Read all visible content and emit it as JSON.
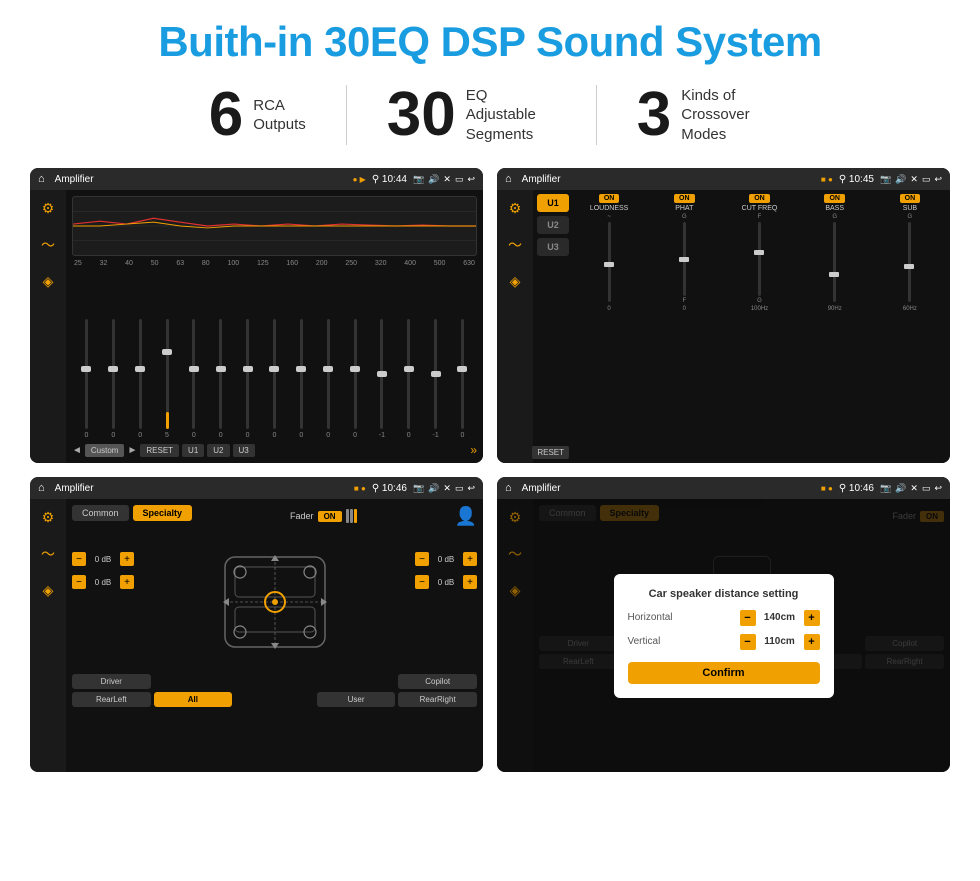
{
  "page": {
    "title": "Buith-in 30EQ DSP Sound System",
    "background": "#ffffff"
  },
  "stats": [
    {
      "number": "6",
      "desc_line1": "RCA",
      "desc_line2": "Outputs"
    },
    {
      "number": "30",
      "desc_line1": "EQ Adjustable",
      "desc_line2": "Segments"
    },
    {
      "number": "3",
      "desc_line1": "Kinds of",
      "desc_line2": "Crossover Modes"
    }
  ],
  "screens": [
    {
      "id": "eq-screen",
      "status_bar": {
        "app_name": "Amplifier",
        "time": "10:44"
      },
      "eq": {
        "freqs": [
          "25",
          "32",
          "40",
          "50",
          "63",
          "80",
          "100",
          "125",
          "160",
          "200",
          "250",
          "320",
          "400",
          "500",
          "630"
        ],
        "values": [
          "0",
          "0",
          "0",
          "5",
          "0",
          "0",
          "0",
          "0",
          "0",
          "0",
          "0",
          "-1",
          "0",
          "-1"
        ],
        "mode": "Custom",
        "buttons": [
          "RESET",
          "U1",
          "U2",
          "U3"
        ]
      }
    },
    {
      "id": "crossover-screen",
      "status_bar": {
        "app_name": "Amplifier",
        "time": "10:45"
      },
      "presets": [
        "U1",
        "U2",
        "U3"
      ],
      "channels": [
        {
          "label": "LOUDNESS",
          "on": true
        },
        {
          "label": "PHAT",
          "on": true
        },
        {
          "label": "CUT FREQ",
          "on": true
        },
        {
          "label": "BASS",
          "on": true
        },
        {
          "label": "SUB",
          "on": true
        }
      ]
    },
    {
      "id": "fader-screen",
      "status_bar": {
        "app_name": "Amplifier",
        "time": "10:46"
      },
      "tabs": [
        "Common",
        "Specialty"
      ],
      "fader_label": "Fader",
      "fader_on": true,
      "db_values": [
        "0 dB",
        "0 dB",
        "0 dB",
        "0 dB"
      ],
      "bottom_btns": [
        "Driver",
        "",
        "",
        "",
        "Copilot"
      ],
      "bottom_btns2": [
        "RearLeft",
        "All",
        "",
        "User",
        "RearRight"
      ]
    },
    {
      "id": "dialog-screen",
      "status_bar": {
        "app_name": "Amplifier",
        "time": "10:46"
      },
      "dialog": {
        "title": "Car speaker distance setting",
        "horizontal_label": "Horizontal",
        "horizontal_value": "140cm",
        "vertical_label": "Vertical",
        "vertical_value": "110cm",
        "confirm_label": "Confirm"
      }
    }
  ]
}
